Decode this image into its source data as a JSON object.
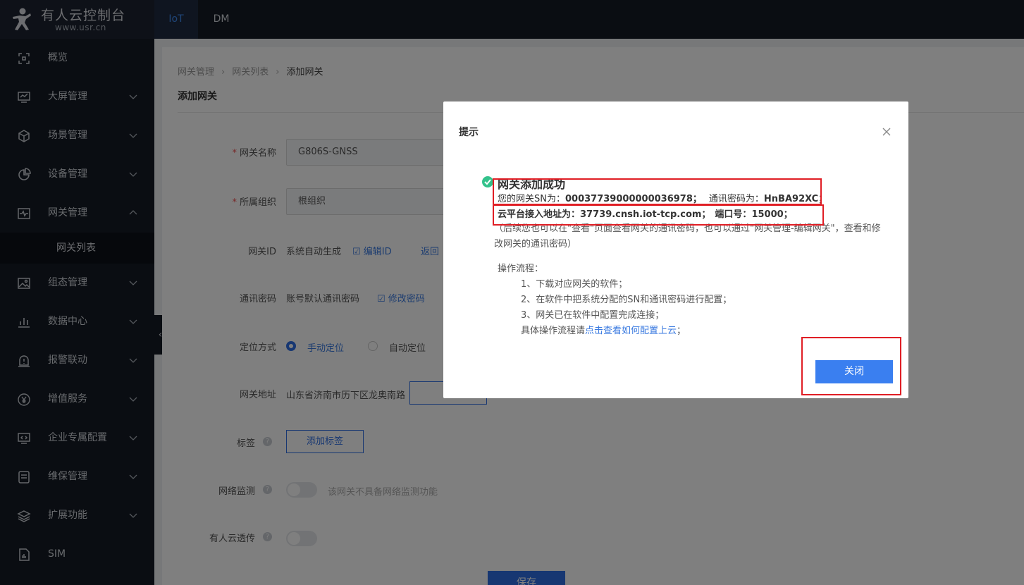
{
  "brand": {
    "title": "有人云控制台",
    "url": "www.usr.cn"
  },
  "top_tabs": [
    {
      "label": "IoT"
    },
    {
      "label": "DM"
    }
  ],
  "sidebar": {
    "items": [
      {
        "label": "概览",
        "icon": "overview-icon"
      },
      {
        "label": "大屏管理",
        "icon": "screen-icon"
      },
      {
        "label": "场景管理",
        "icon": "cube-icon"
      },
      {
        "label": "设备管理",
        "icon": "pie-icon"
      },
      {
        "label": "网关管理",
        "icon": "gateway-icon"
      },
      {
        "label": "组态管理",
        "icon": "image-icon"
      },
      {
        "label": "数据中心",
        "icon": "bar-chart-icon"
      },
      {
        "label": "报警联动",
        "icon": "alarm-icon"
      },
      {
        "label": "增值服务",
        "icon": "yen-icon"
      },
      {
        "label": "企业专属配置",
        "icon": "monitor-code-icon"
      },
      {
        "label": "维保管理",
        "icon": "document-icon"
      },
      {
        "label": "扩展功能",
        "icon": "layers-icon"
      },
      {
        "label": "SIM",
        "icon": "sim-icon"
      }
    ],
    "sub_item": "网关列表"
  },
  "breadcrumb": {
    "level1": "网关管理",
    "level2": "网关列表",
    "current": "添加网关"
  },
  "page_title": "添加网关",
  "form": {
    "name_label": "网关名称",
    "name_value": "G806S-GNSS",
    "group_label": "所属组织",
    "group_value": "根组织",
    "id_label": "网关ID",
    "id_value": "系统自动生成",
    "edit_id": "编辑ID",
    "return_partial": "返回",
    "pwd_label": "通讯密码",
    "pwd_value": "账号默认通讯密码",
    "edit_pwd": "修改密码",
    "loc_label": "定位方式",
    "loc_manual": "手动定位",
    "loc_auto": "自动定位",
    "addr_label": "网关地址",
    "addr_value": "山东省济南市历下区龙奥南路",
    "tag_label": "标签",
    "add_tag": "添加标签",
    "net_label": "网络监测",
    "net_hint": "该网关不具备网络监测功能",
    "passthrough_label": "有人云透传",
    "save": "保存"
  },
  "modal": {
    "title": "提示",
    "success": "网关添加成功",
    "sn_prefix": "您的网关SN为：",
    "sn": "00037739000000036978；",
    "pwd_prefix": "通讯密码为：",
    "pwd": "HnBA92XC；",
    "addr_prefix": "云平台接入地址为：",
    "addr": "37739.cnsh.iot-tcp.com；",
    "port_prefix": "端口号：",
    "port": "15000；",
    "note": "（后续您也可以在\"查看\"页面查看网关的通讯密码，也可以通过\"网关管理-编辑网关\"，查看和修改网关的通讯密码）",
    "steps_title": "操作流程：",
    "step1": "1、下载对应网关的软件；",
    "step2": "2、在软件中把系统分配的SN和通讯密码进行配置；",
    "step3": "3、网关已在软件中配置完成连接；",
    "step4_prefix": "具体操作流程请",
    "step4_link": "点击查看如何配置上云",
    "step4_suffix": "；",
    "close": "关闭"
  }
}
